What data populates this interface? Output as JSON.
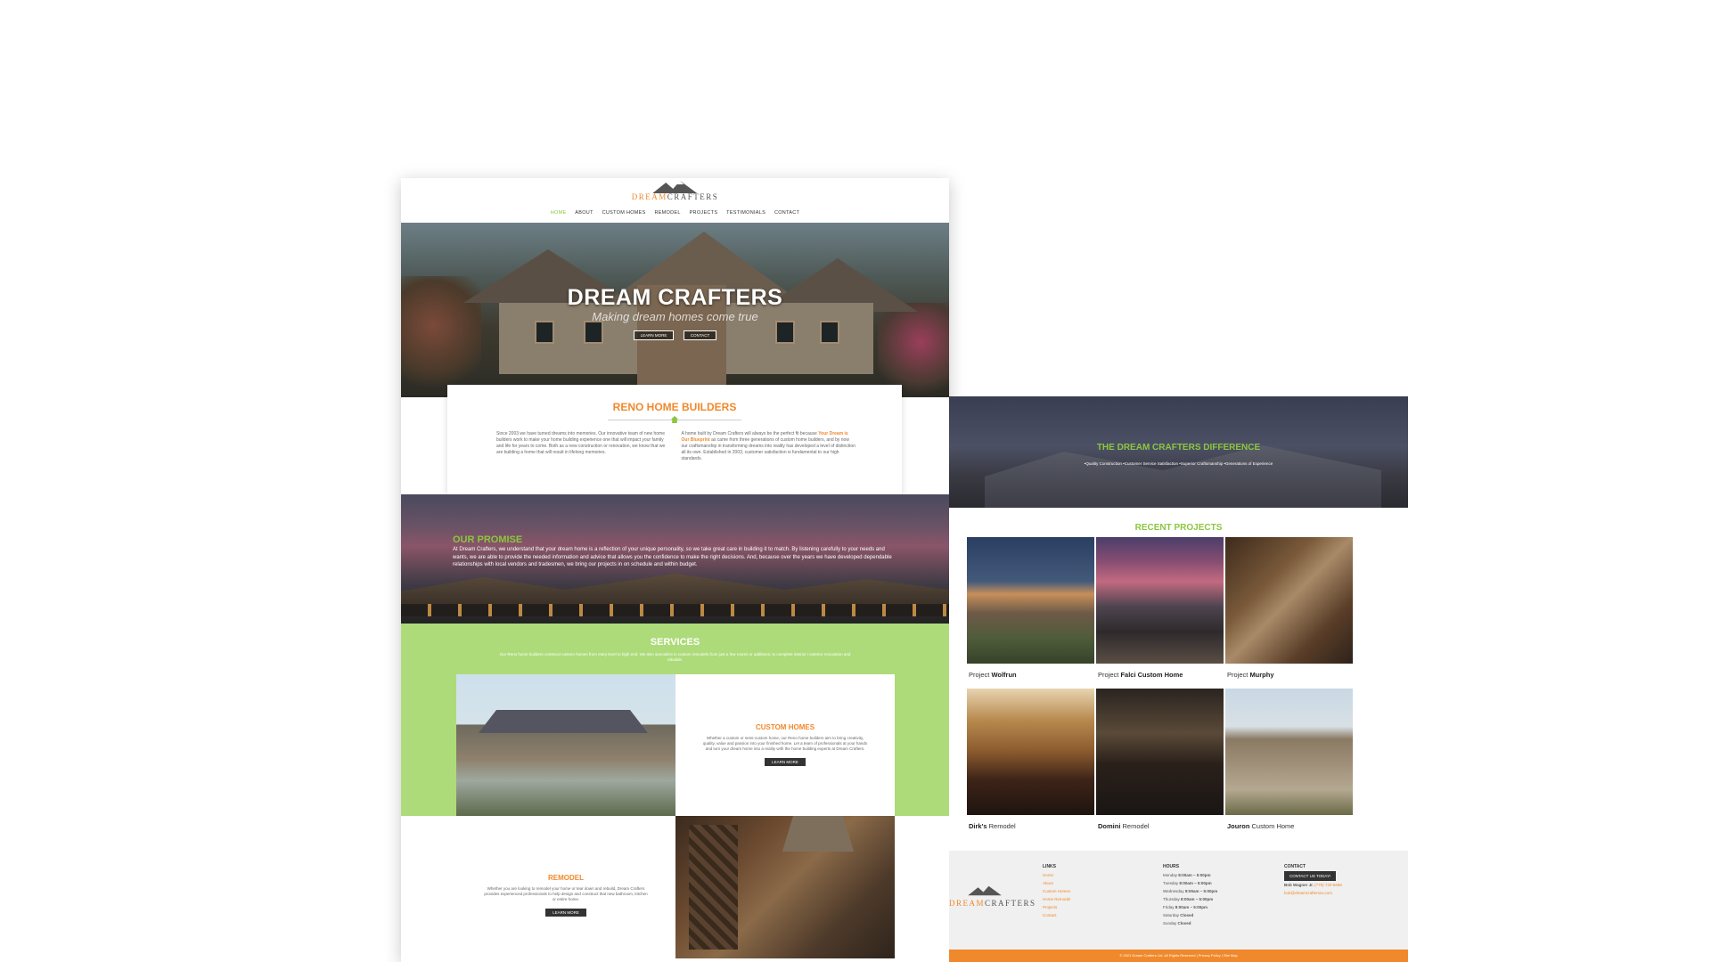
{
  "brand": {
    "logo_left": "DREAM",
    "logo_right": "CRAFTERS"
  },
  "nav": [
    "HOME",
    "ABOUT",
    "CUSTOM HOMES",
    "REMODEL",
    "PROJECTS",
    "TESTIMONIALS",
    "CONTACT"
  ],
  "hero": {
    "title": "DREAM CRAFTERS",
    "subtitle": "Making dream homes come true",
    "learn_more": "LEARN MORE",
    "contact": "CONTACT"
  },
  "intro": {
    "title": "RENO HOME BUILDERS",
    "col1": "Since 2003 we have turned dreams into memories. Our innovative team of new home builders work to make your home building experience one that will impact your family and life for years to come. Both as a new construction or renovation, we know that we are building a home that will result in lifelong memories.",
    "col2_a": "A home built by Dream Crafters will always be the perfect fit because",
    "col2_hl": "Your Dream is Our Blueprint",
    "col2_b": "as came from three generations of custom home builders, and by now our craftsmanship in transforming dreams into reality has developed a level of distinction all its own. Established in 2003, customer satisfaction is fundamental to our high standards."
  },
  "promise": {
    "title": "OUR PROMISE",
    "text": "At Dream Crafters, we understand that your dream home is a reflection of your unique personality, so we take great care in building it to match. By listening carefully to your needs and wants, we are able to provide the needed information and advice that allows you the confidence to make the right decisions. And, because over the years we have developed dependable relationships with local vendors and tradesmen, we bring our projects in on schedule and within budget."
  },
  "services": {
    "title": "SERVICES",
    "subtitle": "Our Reno home builders construct custom homes from entry level to high end. We also specialize in custom remodels from just a few rooms or additions, to complete interior / exterior renovation and rebuilds.",
    "custom_homes": {
      "title": "CUSTOM HOMES",
      "text": "Whether a custom or semi-custom home, our Reno home builders aim to bring creativity, quality, value and passion into your finished home. Let a team of professionals at your hands and turn your dream home into a reality with the home building experts at Dream Crafters.",
      "button": "LEARN MORE"
    },
    "remodel": {
      "title": "REMODEL",
      "text": "Whether you are looking to remodel your home or tear down and rebuild, Dream Crafters provides experienced professionals to help design and construct that new bathroom, kitchen or entire home.",
      "button": "LEARN MORE"
    }
  },
  "difference": {
    "title": "THE DREAM CRAFTERS DIFFERENCE",
    "subtitle": "•Quality Construction  •Customer Service Satisfaction  •Superior Craftsmanship  •Generations of Experience"
  },
  "recent": {
    "title": "RECENT PROJECTS",
    "projects": [
      {
        "prefix": "Project",
        "name": "Wolfrun",
        "suffix": ""
      },
      {
        "prefix": "Project",
        "name": "Falci Custom Home",
        "suffix": ""
      },
      {
        "prefix": "Project",
        "name": "Murphy",
        "suffix": ""
      },
      {
        "prefix": "",
        "name": "Dirk's",
        "suffix": "Remodel"
      },
      {
        "prefix": "",
        "name": "Domini",
        "suffix": "Remodel"
      },
      {
        "prefix": "",
        "name": "Jouron",
        "suffix": "Custom Home"
      }
    ]
  },
  "footer": {
    "links_title": "LINKS",
    "links": [
      "Home",
      "About",
      "Custom Homes",
      "Home Remodel",
      "Projects",
      "Contact"
    ],
    "hours_title": "HOURS",
    "hours": [
      [
        "Monday",
        "8:00am – 5:00pm"
      ],
      [
        "Tuesday",
        "8:00am – 5:00pm"
      ],
      [
        "Wednesday",
        "8:00am – 5:00pm"
      ],
      [
        "Thursday",
        "8:00am – 5:00pm"
      ],
      [
        "Friday",
        "8:00am – 5:00pm"
      ],
      [
        "Saturday",
        "Closed"
      ],
      [
        "Sunday",
        "Closed"
      ]
    ],
    "contact_title": "CONTACT",
    "contact_button": "CONTACT US TODAY!",
    "contact_name": "Bob Wagner Jr.",
    "contact_phone": "(775) 720-5686",
    "contact_email": "bob@dreamcraftersnv.com",
    "copyright": "© 2021 Dream Crafters Ltd. All Rights Reserved | Privacy Policy | Site Map"
  }
}
